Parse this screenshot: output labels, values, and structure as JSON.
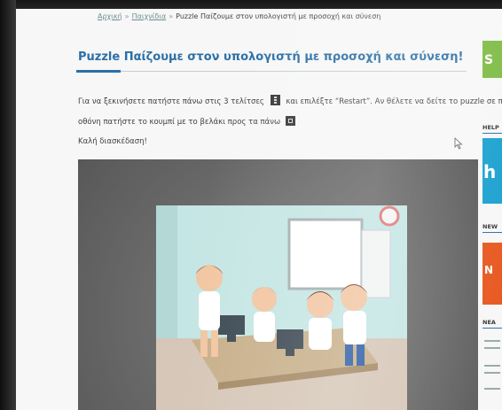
{
  "breadcrumb": {
    "home": "Αρχική",
    "section": "Παιχνίδια",
    "current": "Puzzle Παίζουμε στον υπολογιστή με προσοχή και σύνεση"
  },
  "article": {
    "title": "Puzzle Παίζουμε στον υπολογιστή με προσοχή και σύνεση!",
    "line1_before": "Για να ξεκινήσετε πατήστε πάνω στις 3 τελίτσες",
    "line1_after": "και επιλέξτε “Restart”. Αν θέλετε να δείτε το puzzle σε πλήρη",
    "line2": "οθόνη πατήστε το κουμπί με το βελάκι προς τα πάνω",
    "line3": "Καλή διασκέδαση!"
  },
  "sidebar": {
    "green_banner": "S",
    "help_label": "HELP",
    "blue_banner": "h",
    "news_label": "NEW",
    "orange_banner": "N",
    "recent_label": "ΝΕΑ"
  },
  "colors": {
    "title": "#2c6fa6",
    "sidebar_green": "#7dbb43",
    "sidebar_blue": "#1aa0cf",
    "sidebar_orange": "#e8571f"
  },
  "icons": [
    "three-dots-menu-icon",
    "fullscreen-icon",
    "mouse-cursor-icon"
  ]
}
